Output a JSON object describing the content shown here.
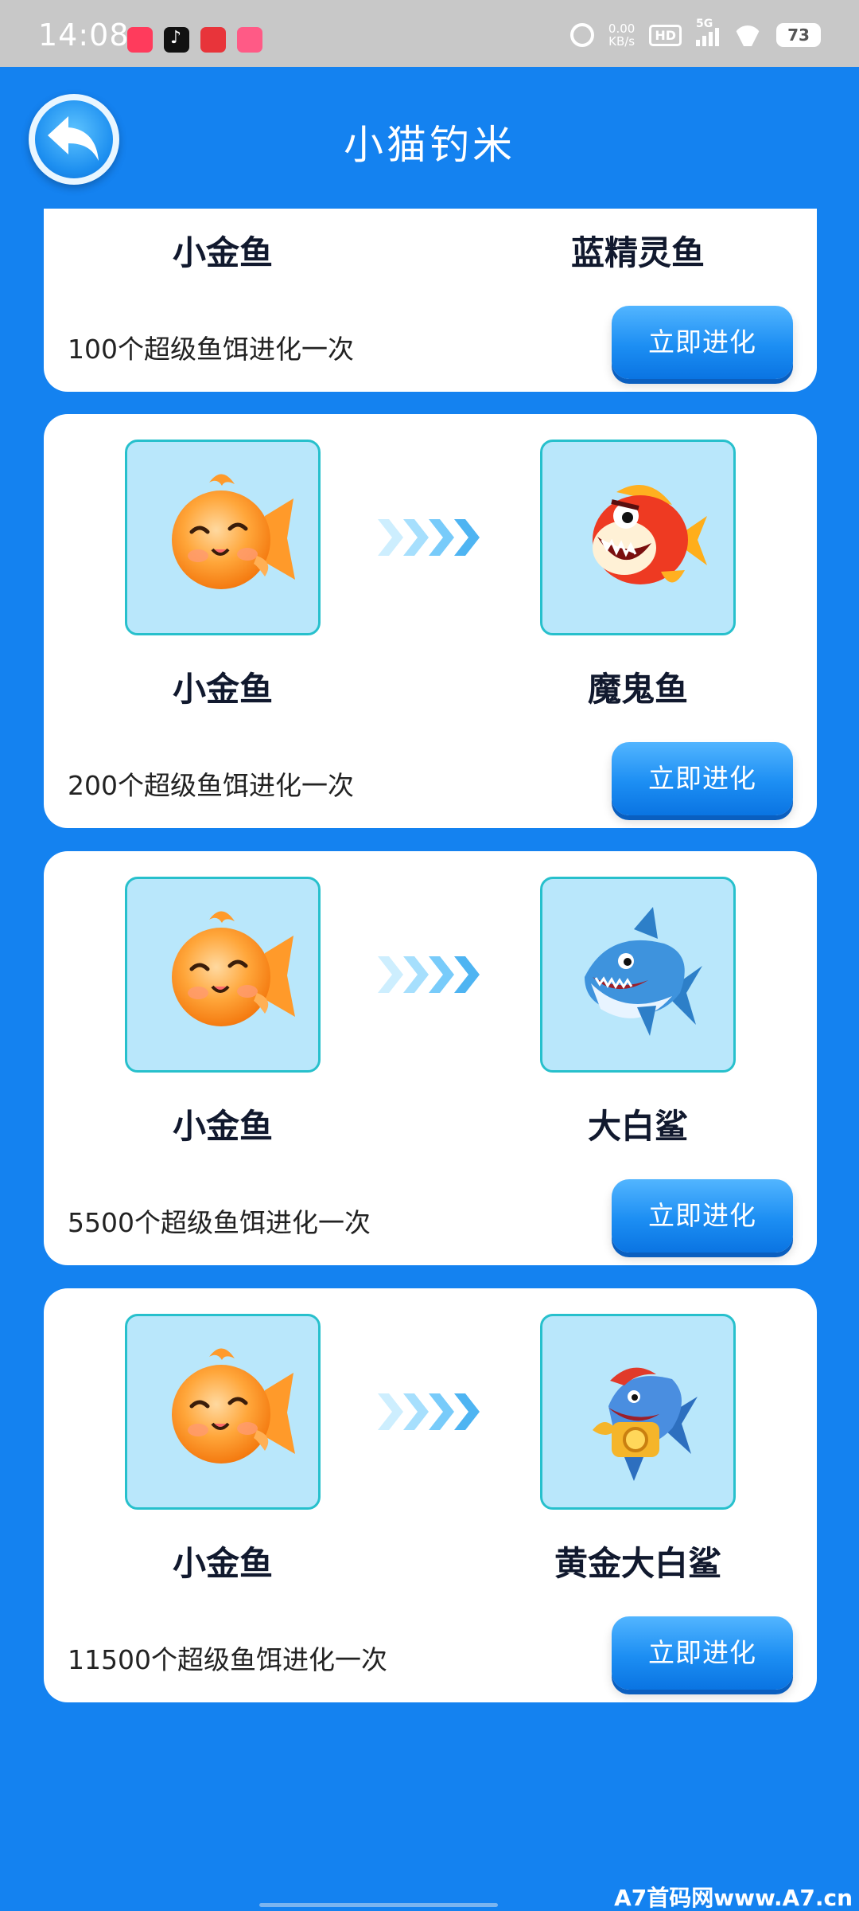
{
  "status_bar": {
    "time": "14:08",
    "net_speed_value": "0.00",
    "net_speed_unit": "KB/s",
    "hd_label": "HD",
    "network_label": "5G",
    "battery": "73"
  },
  "header": {
    "title": "小猫钓米"
  },
  "evolutions": [
    {
      "from_fish": "小金鱼",
      "to_fish": "蓝精灵鱼",
      "cost_text": "100个超级鱼饵进化一次",
      "button_label": "立即进化",
      "from_icon": "goldfish-icon",
      "to_icon": "blue-sprite-fish-icon"
    },
    {
      "from_fish": "小金鱼",
      "to_fish": "魔鬼鱼",
      "cost_text": "200个超级鱼饵进化一次",
      "button_label": "立即进化",
      "from_icon": "goldfish-icon",
      "to_icon": "devil-fish-icon"
    },
    {
      "from_fish": "小金鱼",
      "to_fish": "大白鲨",
      "cost_text": "5500个超级鱼饵进化一次",
      "button_label": "立即进化",
      "from_icon": "goldfish-icon",
      "to_icon": "great-white-shark-icon"
    },
    {
      "from_fish": "小金鱼",
      "to_fish": "黄金大白鲨",
      "cost_text": "11500个超级鱼饵进化一次",
      "button_label": "立即进化",
      "from_icon": "goldfish-icon",
      "to_icon": "golden-shark-icon"
    }
  ],
  "watermark": "A7首码网www.A7.cn",
  "colors": {
    "background": "#1482f0",
    "tile": "#b9e7fb",
    "tile_border": "#27c0cc",
    "button": "#1c8ef3"
  }
}
